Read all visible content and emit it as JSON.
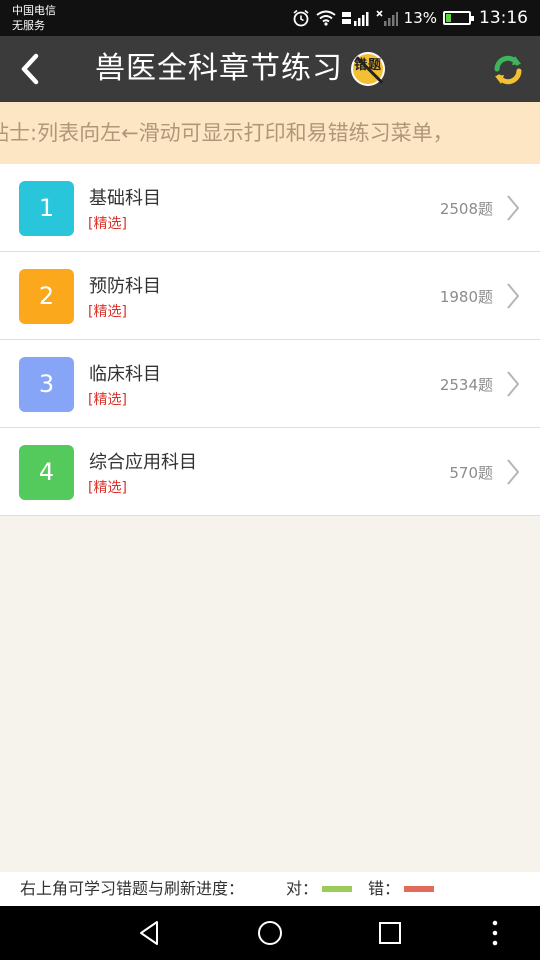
{
  "status_bar": {
    "carrier_line1": "中国电信",
    "carrier_line2": "无服务",
    "battery": "13%",
    "time": "13:16"
  },
  "header": {
    "title": "兽医全科章节练习",
    "back_icon": "chevron-left-icon",
    "wrong_badge_text": "错题",
    "refresh_icon": "refresh-icon"
  },
  "tip": {
    "text": "贴士:列表向左←滑动可显示打印和易错练习菜单，"
  },
  "subjects": [
    {
      "number": "1",
      "title": "基础科目",
      "tag": "[精选]",
      "count": "2508题",
      "color": "#29c6db"
    },
    {
      "number": "2",
      "title": "预防科目",
      "tag": "[精选]",
      "count": "1980题",
      "color": "#fba81c"
    },
    {
      "number": "3",
      "title": "临床科目",
      "tag": "[精选]",
      "count": "2534题",
      "color": "#86a5f7"
    },
    {
      "number": "4",
      "title": "综合应用科目",
      "tag": "[精选]",
      "count": "570题",
      "color": "#55ca5c"
    }
  ],
  "legend": {
    "hint": "右上角可学习错题与刷新进度：",
    "right_label": "对：",
    "wrong_label": "错：",
    "right_color": "#9ccb5b",
    "wrong_color": "#e06b5a"
  },
  "navbar": {
    "back_icon": "triangle-back-icon",
    "home_icon": "circle-home-icon",
    "recents_icon": "square-recents-icon",
    "menu_icon": "dots-menu-icon"
  }
}
